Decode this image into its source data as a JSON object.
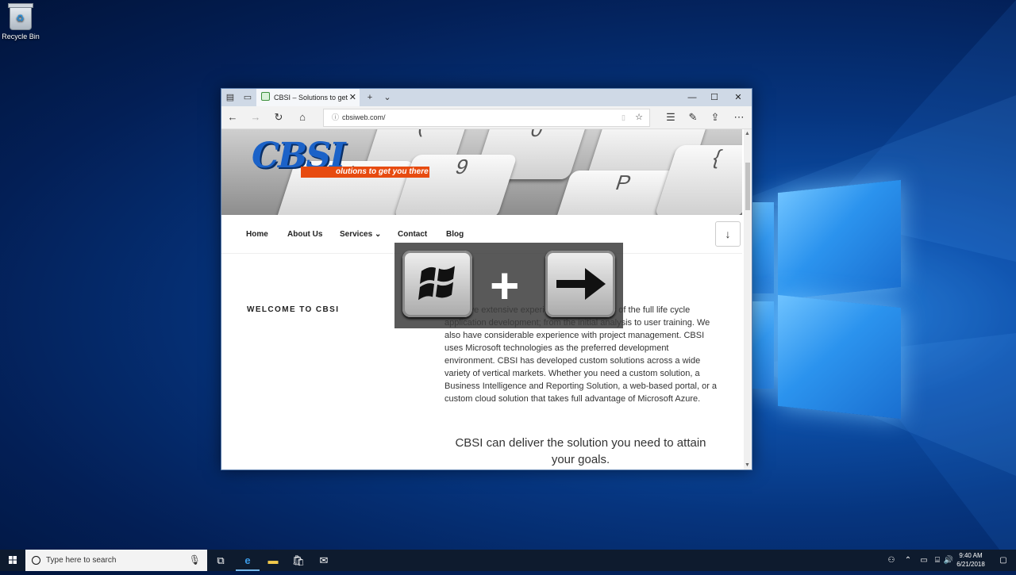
{
  "desktop": {
    "recycle_bin_label": "Recycle Bin"
  },
  "browser": {
    "tab_title": "CBSI – Solutions to get",
    "url": "cbsiweb.com/",
    "window_controls": [
      "—",
      "☐",
      "✕"
    ]
  },
  "site": {
    "logo_text": "CBSI",
    "tagline": "olutions to get you there",
    "menu": {
      "home": "Home",
      "about": "About Us",
      "services": "Services",
      "contact": "Contact",
      "blog": "Blog"
    },
    "welcome_heading": "WELCOME TO CBSI",
    "intro_paragraph": "We have extensive experience in all aspects of the full life cycle application development; from the initial analysis to user training. We also have considerable experience with project management. CBSI uses Microsoft technologies as the preferred development environment. CBSI has developed custom solutions across a wide variety of vertical markets. Whether you need a custom solution, a Business Intelligence and Reporting Solution, a web-based portal, or a custom cloud solution that takes full advantage of Microsoft Azure.",
    "deliver_text": "CBSI can deliver the solution you need to attain your goals."
  },
  "shortcut_overlay": {
    "plus": "+"
  },
  "taskbar": {
    "search_placeholder": "Type here to search",
    "time": "9:40 AM",
    "date": "6/21/2018"
  },
  "colors": {
    "accent_blue": "#1b62c8",
    "brand_orange": "#e74b10",
    "taskbar": "#0e1b2e"
  }
}
